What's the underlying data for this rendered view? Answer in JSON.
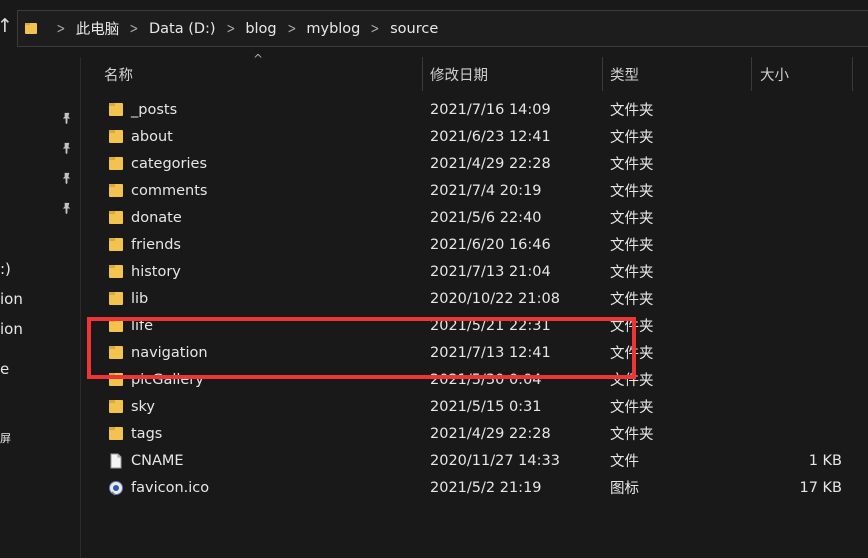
{
  "address_bar": {
    "crumbs": [
      "此电脑",
      "Data (D:)",
      "blog",
      "myblog",
      "source"
    ]
  },
  "nav_fragments": [
    ":)",
    "ion",
    "ion",
    "e",
    "屏"
  ],
  "columns": {
    "name": "名称",
    "date": "修改日期",
    "type": "类型",
    "size": "大小"
  },
  "files": [
    {
      "name": "_posts",
      "date": "2021/7/16 14:09",
      "type": "文件夹",
      "size": "",
      "icon": "folder-icon"
    },
    {
      "name": "about",
      "date": "2021/6/23 12:41",
      "type": "文件夹",
      "size": "",
      "icon": "folder-icon"
    },
    {
      "name": "categories",
      "date": "2021/4/29 22:28",
      "type": "文件夹",
      "size": "",
      "icon": "folder-icon"
    },
    {
      "name": "comments",
      "date": "2021/7/4 20:19",
      "type": "文件夹",
      "size": "",
      "icon": "folder-icon"
    },
    {
      "name": "donate",
      "date": "2021/5/6 22:40",
      "type": "文件夹",
      "size": "",
      "icon": "folder-icon"
    },
    {
      "name": "friends",
      "date": "2021/6/20 16:46",
      "type": "文件夹",
      "size": "",
      "icon": "folder-icon"
    },
    {
      "name": "history",
      "date": "2021/7/13 21:04",
      "type": "文件夹",
      "size": "",
      "icon": "folder-icon"
    },
    {
      "name": "lib",
      "date": "2020/10/22 21:08",
      "type": "文件夹",
      "size": "",
      "icon": "folder-icon"
    },
    {
      "name": "life",
      "date": "2021/5/21 22:31",
      "type": "文件夹",
      "size": "",
      "icon": "folder-icon"
    },
    {
      "name": "navigation",
      "date": "2021/7/13 12:41",
      "type": "文件夹",
      "size": "",
      "icon": "folder-icon"
    },
    {
      "name": "picGallery",
      "date": "2021/5/30 0:04",
      "type": "文件夹",
      "size": "",
      "icon": "folder-icon"
    },
    {
      "name": "sky",
      "date": "2021/5/15 0:31",
      "type": "文件夹",
      "size": "",
      "icon": "folder-icon"
    },
    {
      "name": "tags",
      "date": "2021/4/29 22:28",
      "type": "文件夹",
      "size": "",
      "icon": "folder-icon"
    },
    {
      "name": "CNAME",
      "date": "2020/11/27 14:33",
      "type": "文件",
      "size": "1 KB",
      "icon": "file-icon"
    },
    {
      "name": "favicon.ico",
      "date": "2021/5/2 21:19",
      "type": "图标",
      "size": "17 KB",
      "icon": "favicon-icon"
    }
  ],
  "colors": {
    "background": "#191919",
    "folder": "#f2c34e",
    "highlight": "#ee3434",
    "text": "#e6e6e6"
  }
}
